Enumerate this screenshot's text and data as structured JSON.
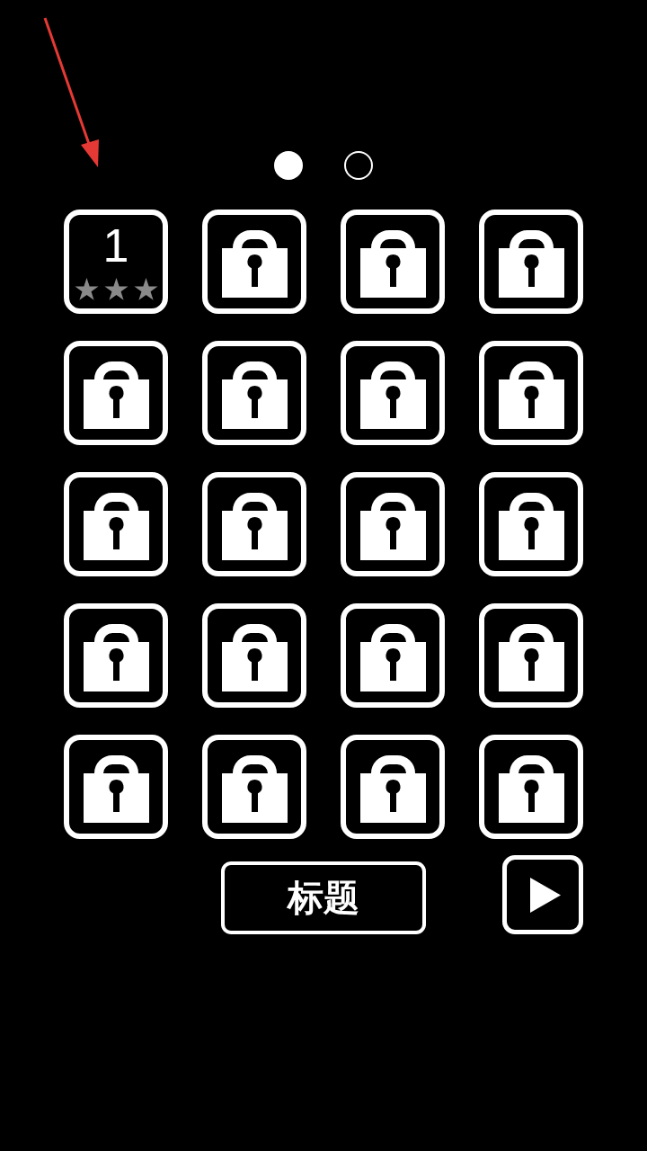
{
  "page_indicator": [
    {
      "selected": true
    },
    {
      "selected": false
    }
  ],
  "levels": [
    {
      "kind": "unlocked",
      "label": "1",
      "stars": 3
    },
    {
      "kind": "locked"
    },
    {
      "kind": "locked"
    },
    {
      "kind": "locked"
    },
    {
      "kind": "locked"
    },
    {
      "kind": "locked"
    },
    {
      "kind": "locked"
    },
    {
      "kind": "locked"
    },
    {
      "kind": "locked"
    },
    {
      "kind": "locked"
    },
    {
      "kind": "locked"
    },
    {
      "kind": "locked"
    },
    {
      "kind": "locked"
    },
    {
      "kind": "locked"
    },
    {
      "kind": "locked"
    },
    {
      "kind": "locked"
    },
    {
      "kind": "locked"
    },
    {
      "kind": "locked"
    },
    {
      "kind": "locked"
    },
    {
      "kind": "locked"
    }
  ],
  "title_button": {
    "label": "标题"
  }
}
